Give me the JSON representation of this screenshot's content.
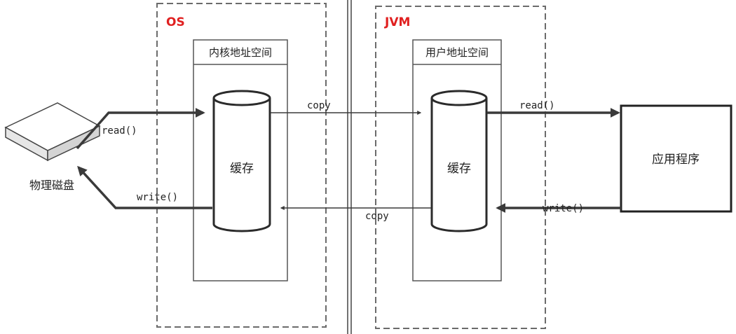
{
  "zones": {
    "os": {
      "label": "OS"
    },
    "jvm": {
      "label": "JVM"
    }
  },
  "boxes": {
    "kernel_space": "内核地址空间",
    "user_space": "用户地址空间"
  },
  "caches": {
    "os_cache": "缓存",
    "jvm_cache": "缓存"
  },
  "disk": {
    "label": "物理磁盘"
  },
  "app": {
    "label": "应用程序"
  },
  "operations": {
    "disk_read": "read()",
    "disk_write": "write()",
    "copy_to_user": "copy",
    "copy_to_kernel": "copy",
    "app_read": "read()",
    "app_write": "write()"
  },
  "colors": {
    "zone_label": "#e02020",
    "line": "#3a3a3a"
  }
}
